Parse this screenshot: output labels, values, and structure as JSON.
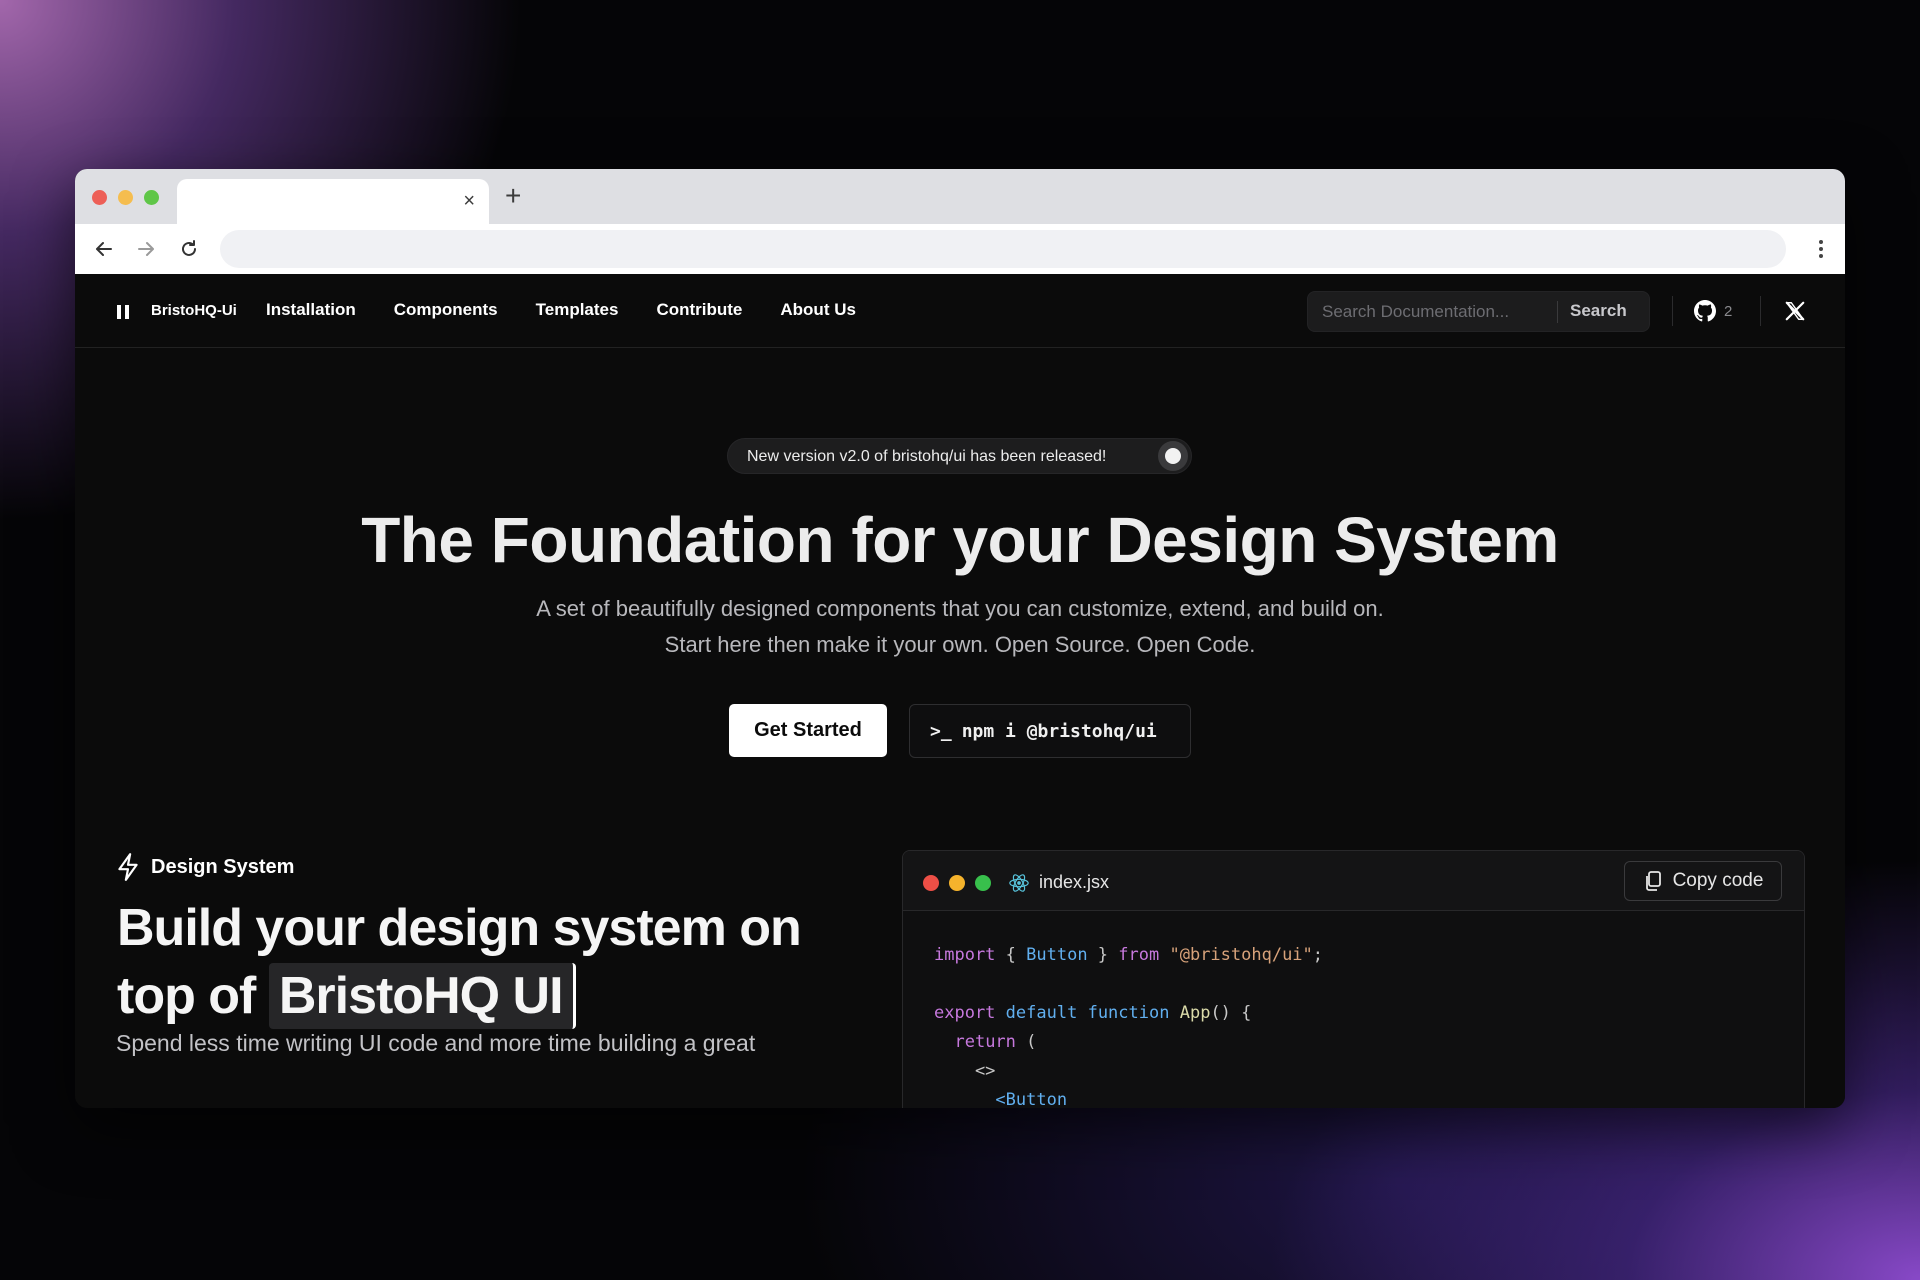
{
  "browser": {
    "tab_title": "",
    "tab_close": "×",
    "new_tab": "+",
    "url": ""
  },
  "nav": {
    "brand": "BristoHQ-Ui",
    "links": [
      "Installation",
      "Components",
      "Templates",
      "Contribute",
      "About Us"
    ],
    "search_placeholder": "Search Documentation...",
    "search_button": "Search",
    "github_count": "2"
  },
  "hero": {
    "badge": "New version v2.0 of bristohq/ui has been released!",
    "title": "The Foundation for your Design System",
    "subtitle": "A set of beautifully designed components that you can customize, extend, and build on. Start here then make it your own. Open Source. Open Code.",
    "primary_button": "Get Started",
    "install_prompt": ">_",
    "install_command": "npm i @bristohq/ui"
  },
  "section": {
    "label": "Design System",
    "title_part1": "Build your design system on top of",
    "title_highlight": "BristoHQ UI",
    "description": "Spend less time writing UI code and more time building a great"
  },
  "code": {
    "filename": "index.jsx",
    "copy_label": "Copy code",
    "line1": {
      "kw_import": "import",
      "open": " { ",
      "name": "Button",
      "close": " } ",
      "kw_from": "from",
      "space": " ",
      "source": "\"@bristohq/ui\"",
      "semi": ";"
    },
    "line3": {
      "kw_export": "export",
      "space1": " ",
      "kw_default": "default",
      "space2": " ",
      "kw_function": "function",
      "space3": " ",
      "name": "App",
      "rest": "() {"
    },
    "line4": {
      "indent": "  ",
      "kw_return": "return",
      "rest": " ("
    },
    "line5": {
      "text": "    <>"
    },
    "line6": {
      "indent": "      ",
      "tag": "<Button"
    }
  },
  "colors": {
    "background": "#050507",
    "page": "#0b0b0b",
    "accent_white": "#ffffff",
    "keyword": "#c678dd",
    "component": "#61afef",
    "string": "#d7a27a"
  },
  "icons": [
    "arrow-left-icon",
    "arrow-right-icon",
    "reload-icon",
    "more-vertical-icon",
    "logo-icon",
    "github-icon",
    "x-icon",
    "lightning-icon",
    "react-icon",
    "copy-icon",
    "terminal-icon"
  ]
}
